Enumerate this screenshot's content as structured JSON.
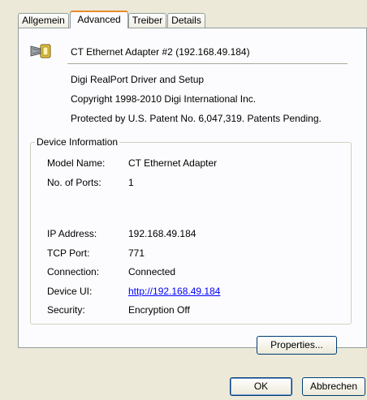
{
  "tabs": [
    {
      "label": "Allgemein",
      "active": false
    },
    {
      "label": "Advanced",
      "active": true
    },
    {
      "label": "Treiber",
      "active": false
    },
    {
      "label": "Details",
      "active": false
    }
  ],
  "header": {
    "device_icon": "serial-connector-icon",
    "device_title": "CT Ethernet Adapter #2 (192.168.49.184)"
  },
  "about": {
    "product": "Digi RealPort Driver and Setup",
    "copyright": "Copyright 1998-2010 Digi International Inc.",
    "patent": "Protected by U.S. Patent No. 6,047,319. Patents Pending."
  },
  "device_info": {
    "legend": "Device Information",
    "model_label": "Model Name:",
    "model_value": "CT Ethernet Adapter",
    "ports_label": "No. of Ports:",
    "ports_value": "1",
    "ip_label": "IP Address:",
    "ip_value": "192.168.49.184",
    "tcp_label": "TCP Port:",
    "tcp_value": "771",
    "conn_label": "Connection:",
    "conn_value": "Connected",
    "ui_label": "Device UI:",
    "ui_value": "http://192.168.49.184",
    "sec_label": "Security:",
    "sec_value": "Encryption Off"
  },
  "buttons": {
    "properties": "Properties...",
    "ok": "OK",
    "cancel": "Abbrechen"
  },
  "colors": {
    "dialog_bg": "#ece9d8",
    "panel_bg": "#fcfcfe",
    "active_tab_accent": "#e68b2c",
    "link": "#0000ff"
  }
}
